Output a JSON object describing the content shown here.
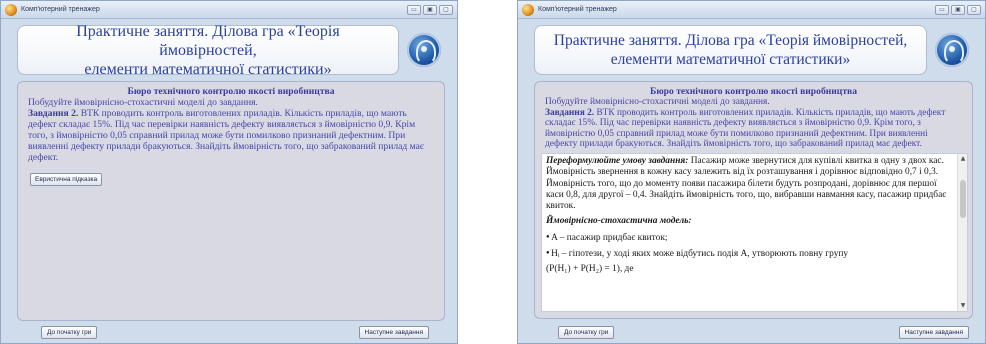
{
  "window": {
    "title": "Комп'ютерний тренажер",
    "controls": [
      "▭",
      "▣",
      "▢"
    ]
  },
  "header": {
    "title_line1": "Практичне заняття. Ділова гра «Теорія ймовірностей,",
    "title_line2": "елементи математичної статистики»"
  },
  "task": {
    "section_title": "Бюро технічного контролю якості виробництва",
    "instruction": "Побудуйте ймовірнісно-стохастичні моделі до завдання.",
    "label": "Завдання 2.",
    "text": "ВТК проводить контроль виготовлених приладів. Кількість приладів, що мають дефект складає 15%. Під час перевірки наявність дефекту виявляється з ймовірністю 0,9. Крім того, з ймовірністю 0,05 справний прилад може бути помилково признаний дефектним. При виявленні дефекту прилади бракуються. Знайдіть ймовірність того, що забракований прилад має дефект."
  },
  "hint_button": "Евристична підказка",
  "hint": {
    "reformulate_label": "Переформулюйте умову завдання:",
    "reformulate_text": "Пасажир може звернутися для купівлі квитка в одну з двох кас. Ймовірність звернення в кожну касу залежить від їх розташування і дорівнює відповідно 0,7 і 0,3. Ймовірність того, що до моменту появи пасажира білети будуть розпродані, дорівнює для першої каси 0,8, для другої – 0,4. Знайдіть ймовірність того, що, вибравши навмання касу, пасажир придбає квиток.",
    "model_label": "Ймовірнісно-стохастична модель:",
    "bullet_a": "A – пасажир придбає квиток;",
    "bullet_h": "Hᵢ – гіпотези, у ході яких може відбутись подія A, утворюють повну групу",
    "formula": "(P(H₁) + P(H₂) = 1), де"
  },
  "footer": {
    "start_label": "До початку гри",
    "next_label": "Наступне завдання"
  }
}
